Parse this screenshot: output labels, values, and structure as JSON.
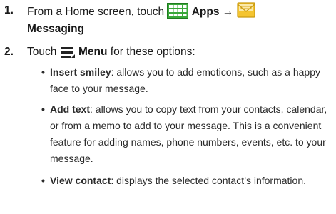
{
  "steps": [
    {
      "number": "1.",
      "line1_prefix": "From a Home screen, touch",
      "apps_label": "Apps",
      "arrow": "→",
      "line2": "Messaging",
      "apps_icon": "apps-grid-icon",
      "messaging_icon": "envelope-icon"
    },
    {
      "number": "2.",
      "prefix": "Touch",
      "menu_label": "Menu",
      "suffix": "for these options:",
      "menu_icon": "menu-icon"
    }
  ],
  "bullets": [
    {
      "term": "Insert smiley",
      "text": ": allows you to add emoticons, such as a happy face to your message."
    },
    {
      "term": "Add text",
      "text": ": allows you to copy text from your contacts, calendar, or from a memo to add to your message. This is a convenient feature for adding names, phone numbers, events, etc. to your message."
    },
    {
      "term": "View contact",
      "text": ": displays the selected contact’s information."
    }
  ],
  "bullet_symbol": "•",
  "colors": {
    "apps_icon_green": "#3aa83a",
    "envelope_yellow": "#f4c430",
    "text": "#1a1a1a"
  }
}
